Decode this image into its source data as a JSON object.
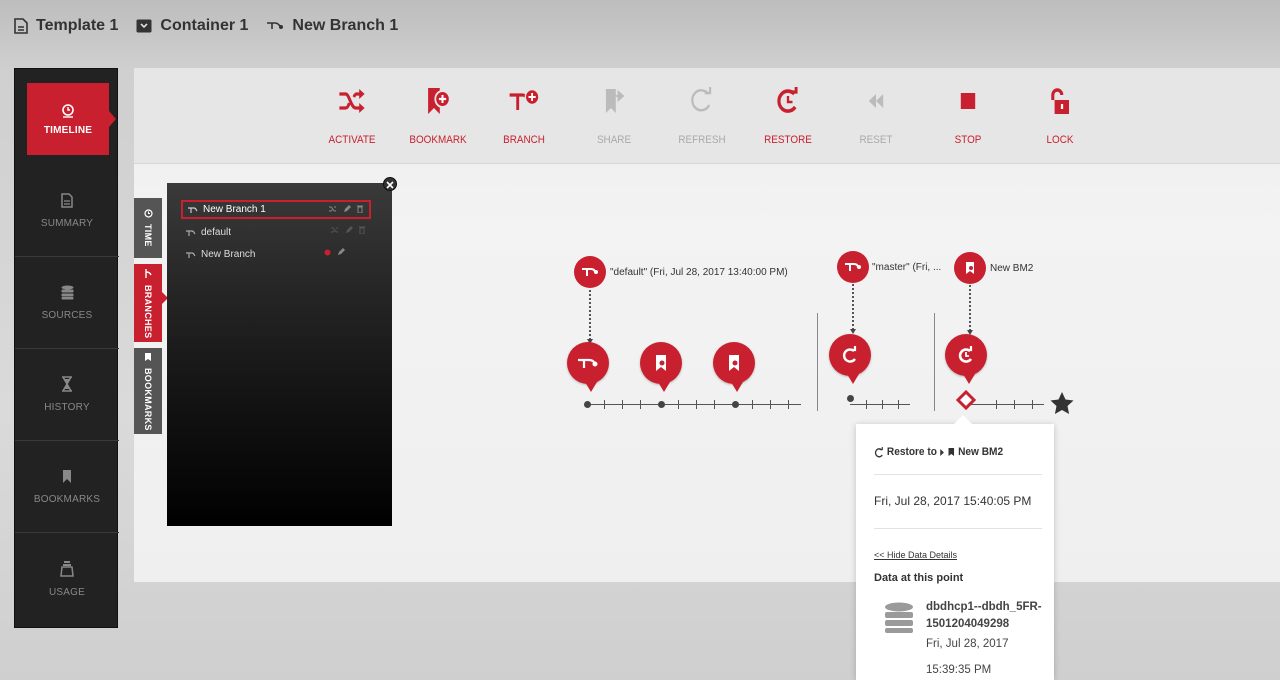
{
  "breadcrumb": {
    "template": "Template 1",
    "container": "Container 1",
    "branch": "New Branch 1"
  },
  "sidebar": {
    "items": [
      {
        "label": "TIMELINE",
        "icon": "clock-icon"
      },
      {
        "label": "SUMMARY",
        "icon": "document-icon"
      },
      {
        "label": "SOURCES",
        "icon": "database-icon"
      },
      {
        "label": "HISTORY",
        "icon": "hourglass-icon"
      },
      {
        "label": "BOOKMARKS",
        "icon": "bookmark-icon"
      },
      {
        "label": "USAGE",
        "icon": "weight-icon"
      }
    ]
  },
  "toolbar": {
    "activate": "ACTIVATE",
    "bookmark": "BOOKMARK",
    "branch": "BRANCH",
    "share": "SHARE",
    "refresh": "REFRESH",
    "restore": "RESTORE",
    "reset": "RESET",
    "stop": "STOP",
    "lock": "LOCK"
  },
  "tabs": {
    "time": "TIME",
    "branches": "BRANCHES",
    "bookmarks": "BOOKMARKS"
  },
  "branches": [
    {
      "name": "New Branch 1",
      "selected": true
    },
    {
      "name": "default",
      "selected": false
    },
    {
      "name": "New Branch",
      "selected": false
    }
  ],
  "timeline": {
    "default_label": "\"default\" (Fri, Jul 28, 2017 13:40:00 PM)",
    "master_label": "\"master\" (Fri, ...",
    "bm_label": "New BM2"
  },
  "popover": {
    "restore_to": "Restore to",
    "bookmark_name": "New BM2",
    "timestamp": "Fri, Jul 28, 2017 15:40:05 PM",
    "hide_link": "<< Hide Data Details",
    "data_heading": "Data at this point",
    "db_name": "dbdhcp1--dbdh_5FR-1501204049298",
    "db_date": "Fri, Jul 28, 2017",
    "db_time": "15:39:35 PM"
  },
  "colors": {
    "accent": "#c8202f",
    "sidebar_bg": "#222222",
    "disabled": "#aaaaaa"
  }
}
